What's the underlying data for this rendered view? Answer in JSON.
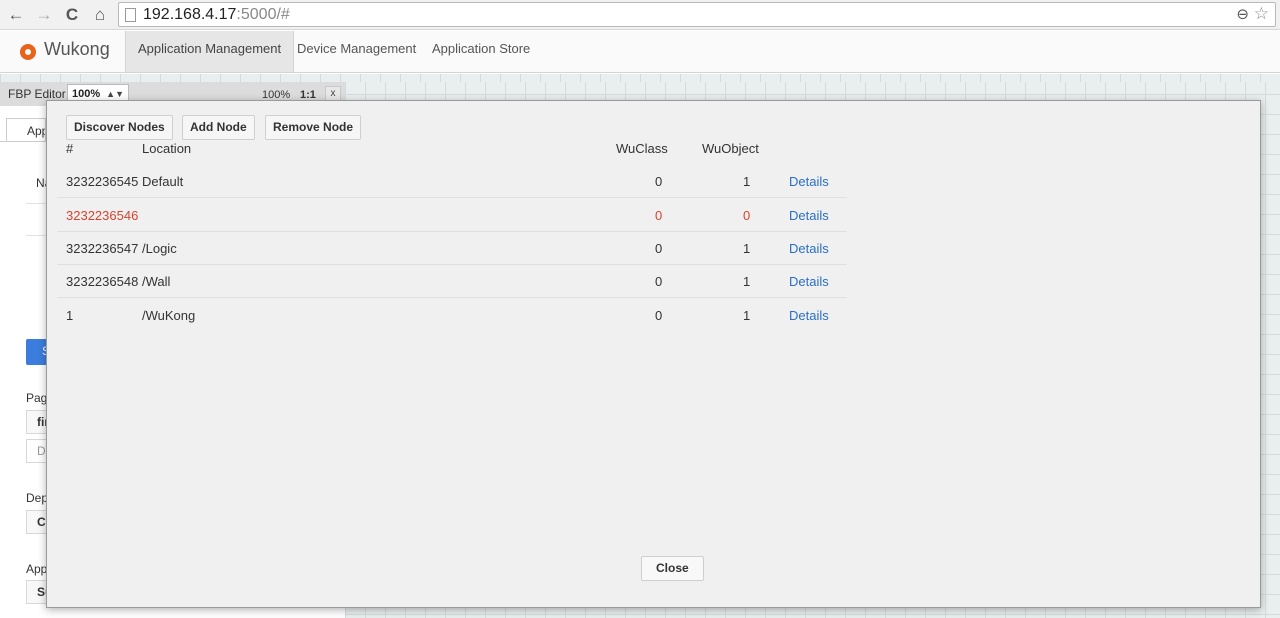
{
  "browser": {
    "url_host": "192.168.4.17",
    "url_rest": ":5000/#",
    "icons": {
      "back": "←",
      "forward": "→",
      "reload": "C",
      "home": "⌂",
      "zoom": "⊖",
      "star": "☆"
    }
  },
  "header": {
    "brand": "Wukong",
    "tabs": [
      {
        "label": "Application Management",
        "active": true
      },
      {
        "label": "Device Management",
        "active": false
      },
      {
        "label": "Application Store",
        "active": false
      }
    ]
  },
  "fbp": {
    "label": "FBP Editor",
    "zoom_select": "100%",
    "zoom_text": "100%",
    "ratio": "1:1",
    "close": "x"
  },
  "background": {
    "tab_label": "App",
    "name_label": "Na",
    "button_label": "S",
    "page_label": "Pag",
    "page_field": "fir",
    "page_field2": "D",
    "deploy_label": "Dep",
    "deploy_field": "Cu",
    "app_label": "App",
    "app_field": "Su"
  },
  "modal": {
    "buttons": {
      "discover": "Discover Nodes",
      "add": "Add Node",
      "remove": "Remove Node"
    },
    "columns": {
      "num": "#",
      "location": "Location",
      "wuclass": "WuClass",
      "wuobject": "WuObject"
    },
    "rows": [
      {
        "id": "3232236545",
        "location": "Default",
        "wuclass": "0",
        "wuobject": "1",
        "details": "Details",
        "error": false
      },
      {
        "id": "3232236546",
        "location": "",
        "wuclass": "0",
        "wuobject": "0",
        "details": "Details",
        "error": true
      },
      {
        "id": "3232236547",
        "location": "/Logic",
        "wuclass": "0",
        "wuobject": "1",
        "details": "Details",
        "error": false
      },
      {
        "id": "3232236548",
        "location": "/Wall",
        "wuclass": "0",
        "wuobject": "1",
        "details": "Details",
        "error": false
      },
      {
        "id": "1",
        "location": "/WuKong",
        "wuclass": "0",
        "wuobject": "1",
        "details": "Details",
        "error": false
      }
    ],
    "close_label": "Close"
  },
  "colors": {
    "accent": "#e8641b",
    "link": "#2a6fc9",
    "error": "#d64430"
  }
}
